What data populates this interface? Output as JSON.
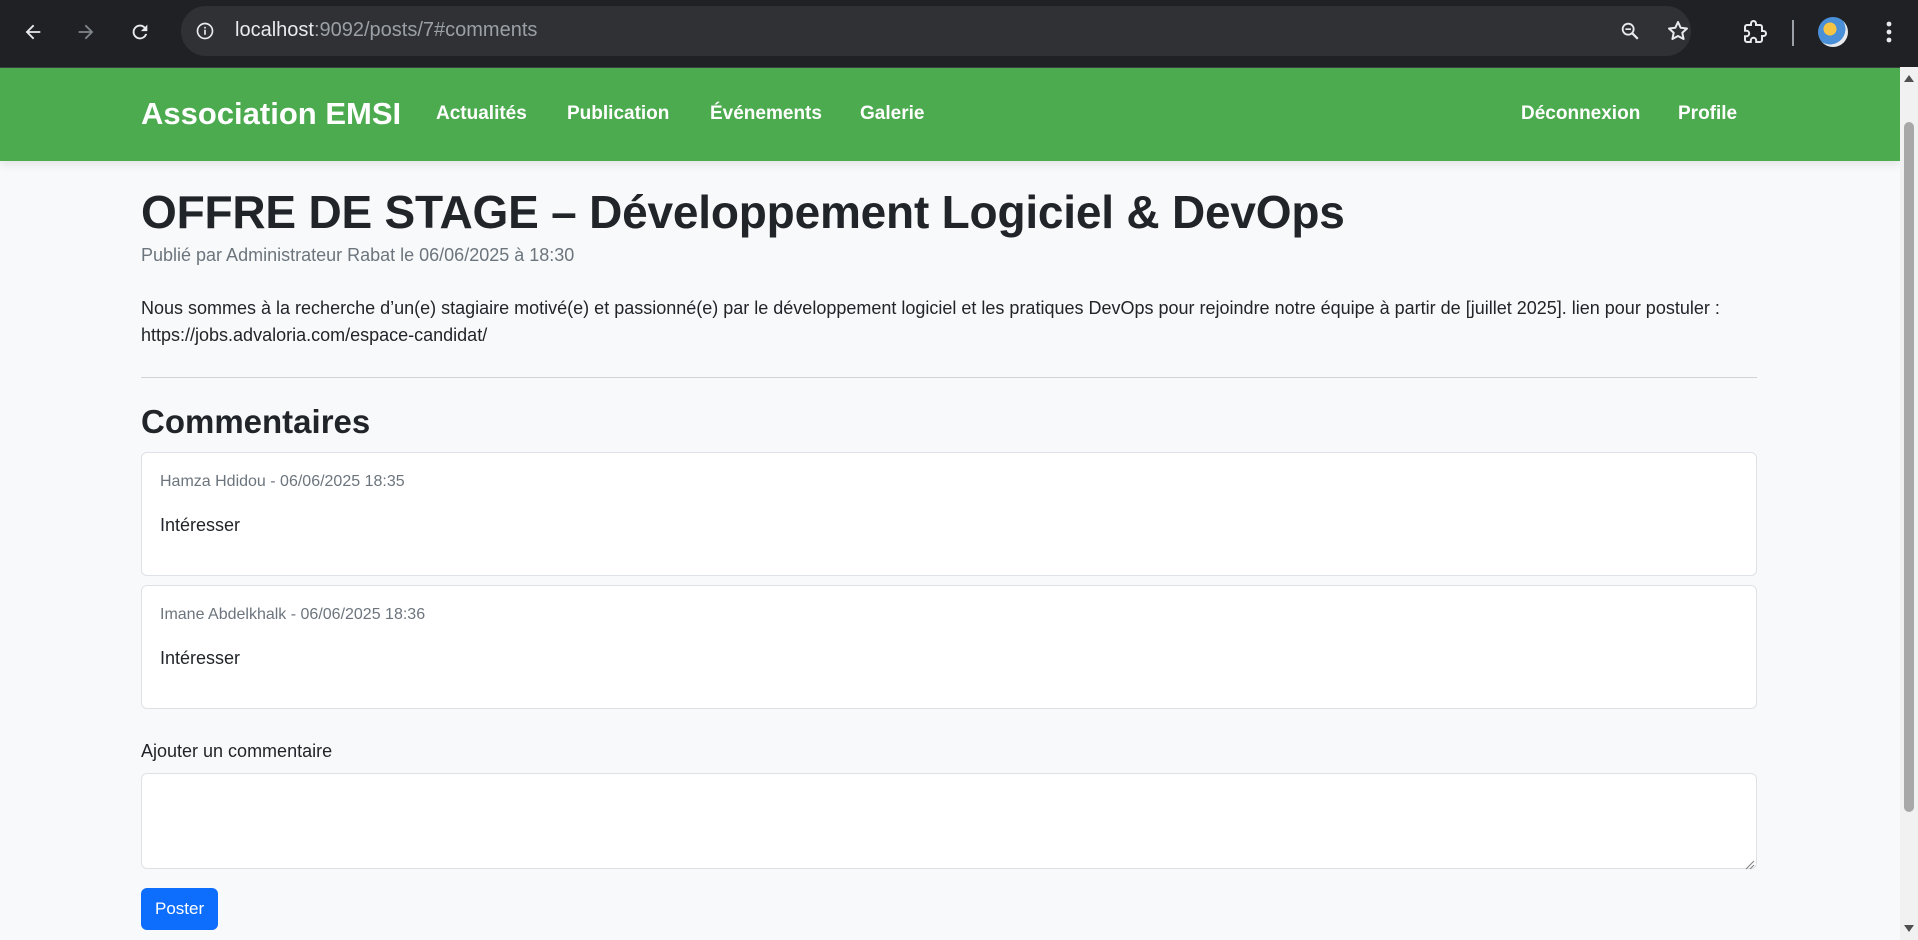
{
  "browser": {
    "url_host": "localhost",
    "url_rest": ":9092/posts/7#comments",
    "icons": [
      "back-arrow-icon",
      "forward-arrow-icon",
      "reload-icon",
      "info-icon",
      "zoom-icon",
      "star-icon",
      "extensions-icon",
      "profile-avatar",
      "menu-dots-icon"
    ]
  },
  "navbar": {
    "brand": "Association EMSI",
    "links": [
      "Actualités",
      "Publication",
      "Événements",
      "Galerie"
    ],
    "right_links": [
      "Déconnexion",
      "Profile"
    ],
    "color": "#4caa4f"
  },
  "post": {
    "title": "OFFRE DE STAGE – Développement Logiciel & DevOps",
    "meta": "Publié par Administrateur Rabat le 06/06/2025 à 18:30",
    "body_line1": "Nous sommes à la recherche d’un(e) stagiaire motivé(e) et passionné(e) par le développement logiciel et les pratiques DevOps pour rejoindre notre équipe à partir de [juillet 2025]. lien pour postuler :",
    "body_line2": "https://jobs.advaloria.com/espace-candidat/"
  },
  "comments": {
    "heading": "Commentaires",
    "items": [
      {
        "meta": "Hamza Hdidou - 06/06/2025 18:35",
        "text": "Intéresser"
      },
      {
        "meta": "Imane Abdelkhalk - 06/06/2025 18:36",
        "text": "Intéresser"
      }
    ]
  },
  "form": {
    "label": "Ajouter un commentaire",
    "value": "",
    "submit_label": "Poster",
    "button_color": "#0d6efd"
  }
}
